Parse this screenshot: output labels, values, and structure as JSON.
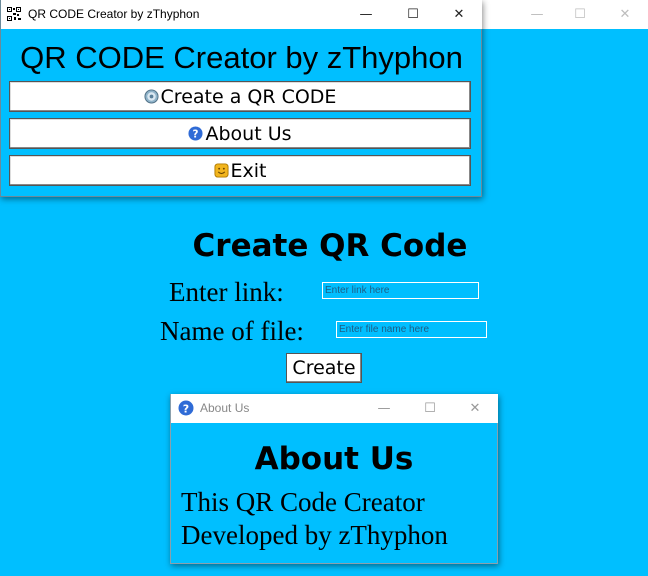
{
  "background_window": {
    "controls": {
      "minimize": "—",
      "maximize": "☐",
      "close": "✕"
    },
    "create_panel": {
      "title": "Create QR Code",
      "link_label": "Enter link:",
      "link_placeholder": "Enter link here",
      "file_label": "Name of file:",
      "file_placeholder": "Enter file name here",
      "create_button": "Create"
    }
  },
  "main_window": {
    "title": "QR CODE Creator by zThyphon",
    "controls": {
      "minimize": "—",
      "maximize": "☐",
      "close": "✕"
    },
    "heading": "QR CODE Creator by zThyphon",
    "buttons": [
      {
        "label": "Create a QR CODE",
        "icon": "disc-icon"
      },
      {
        "label": "About Us",
        "icon": "help-icon"
      },
      {
        "label": "Exit",
        "icon": "smiley-icon"
      }
    ]
  },
  "about_window": {
    "title": "About Us",
    "controls": {
      "minimize": "—",
      "maximize": "☐",
      "close": "✕"
    },
    "heading": "About Us",
    "lines": [
      "This QR Code Creator",
      "Developed by zThyphon"
    ]
  },
  "colors": {
    "background": "#00bfff",
    "titlebar": "#ffffff",
    "help_icon": "#2f6bd6"
  }
}
